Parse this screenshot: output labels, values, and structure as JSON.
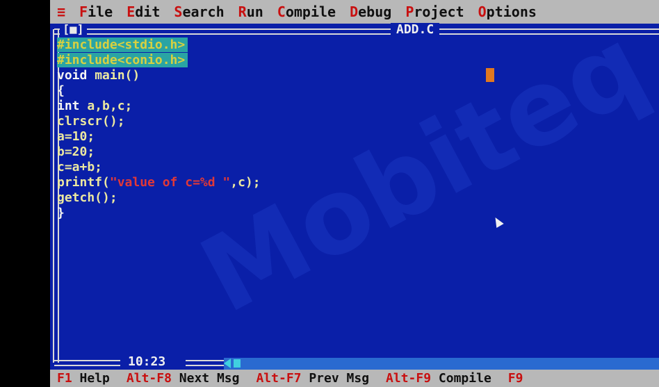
{
  "menu": {
    "system_glyph": "≡",
    "items": [
      {
        "hot": "F",
        "rest": "ile"
      },
      {
        "hot": "E",
        "rest": "dit"
      },
      {
        "hot": "S",
        "rest": "earch"
      },
      {
        "hot": "R",
        "rest": "un"
      },
      {
        "hot": "C",
        "rest": "ompile"
      },
      {
        "hot": "D",
        "rest": "ebug"
      },
      {
        "hot": "P",
        "rest": "roject"
      },
      {
        "hot": "O",
        "rest": "ptions"
      }
    ]
  },
  "editor": {
    "close_box": "[■]",
    "title": "ADD.C",
    "clock": "10:23",
    "lines": {
      "l1": "#include<stdio.h>",
      "l2": "#include<conio.h>",
      "l3_kw": "void",
      "l3_rest": " main()",
      "l4": "{",
      "l5_kw": "int",
      "l5_rest": " a,b,c;",
      "l6": "clrscr();",
      "l7": "a=10;",
      "l8": "b=20;",
      "l9": "c=a+b;",
      "l10_a": "printf(",
      "l10_str": "\"value of c=%d \"",
      "l10_b": ",c);",
      "l11": "getch();",
      "l12": "}"
    }
  },
  "watermark": "Mobiteq Aca",
  "statusbar": {
    "items": [
      {
        "key": "F1",
        "label": "Help"
      },
      {
        "key": "Alt-F8",
        "label": "Next Msg"
      },
      {
        "key": "Alt-F7",
        "label": "Prev Msg"
      },
      {
        "key": "Alt-F9",
        "label": "Compile"
      },
      {
        "key": "F9",
        "label": ""
      }
    ]
  },
  "colors": {
    "editor_bg": "#0a1fa8",
    "menu_bg": "#b8b8b8",
    "hotkey": "#c81010",
    "highlight": "#2aa4a4",
    "cursor": "#e07820"
  }
}
